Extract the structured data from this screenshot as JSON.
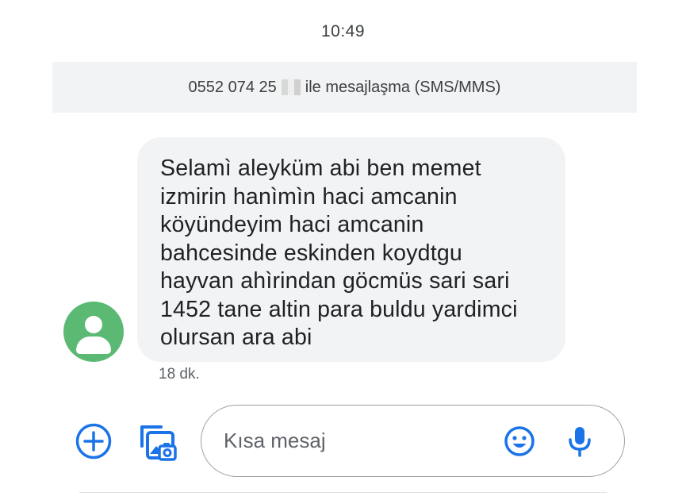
{
  "header": {
    "time": "10:49"
  },
  "banner": {
    "number": "0552 074 25",
    "suffix": "ile mesajlaşma (SMS/MMS)"
  },
  "message": {
    "text": "Selamì aleyküm abi ben memet\nizmirin hanìmìn haci amcanin\nköyündeyim haci amcanin\nbahcesinde eskinden koydtgu\nhayvan ahìrindan göcmüs sari sari\n1452 tane altin para buldu yardimci\nolursan ara abi",
    "time": "18 dk."
  },
  "compose": {
    "placeholder": "Kısa mesaj"
  },
  "icons": {
    "avatar": "person-icon",
    "add": "add-circle-icon",
    "gallery": "gallery-icon",
    "emoji": "emoji-icon",
    "mic": "mic-icon"
  },
  "colors": {
    "accent": "#1a73e8",
    "avatar": "#5bb974",
    "bubble": "#f1f3f4"
  }
}
